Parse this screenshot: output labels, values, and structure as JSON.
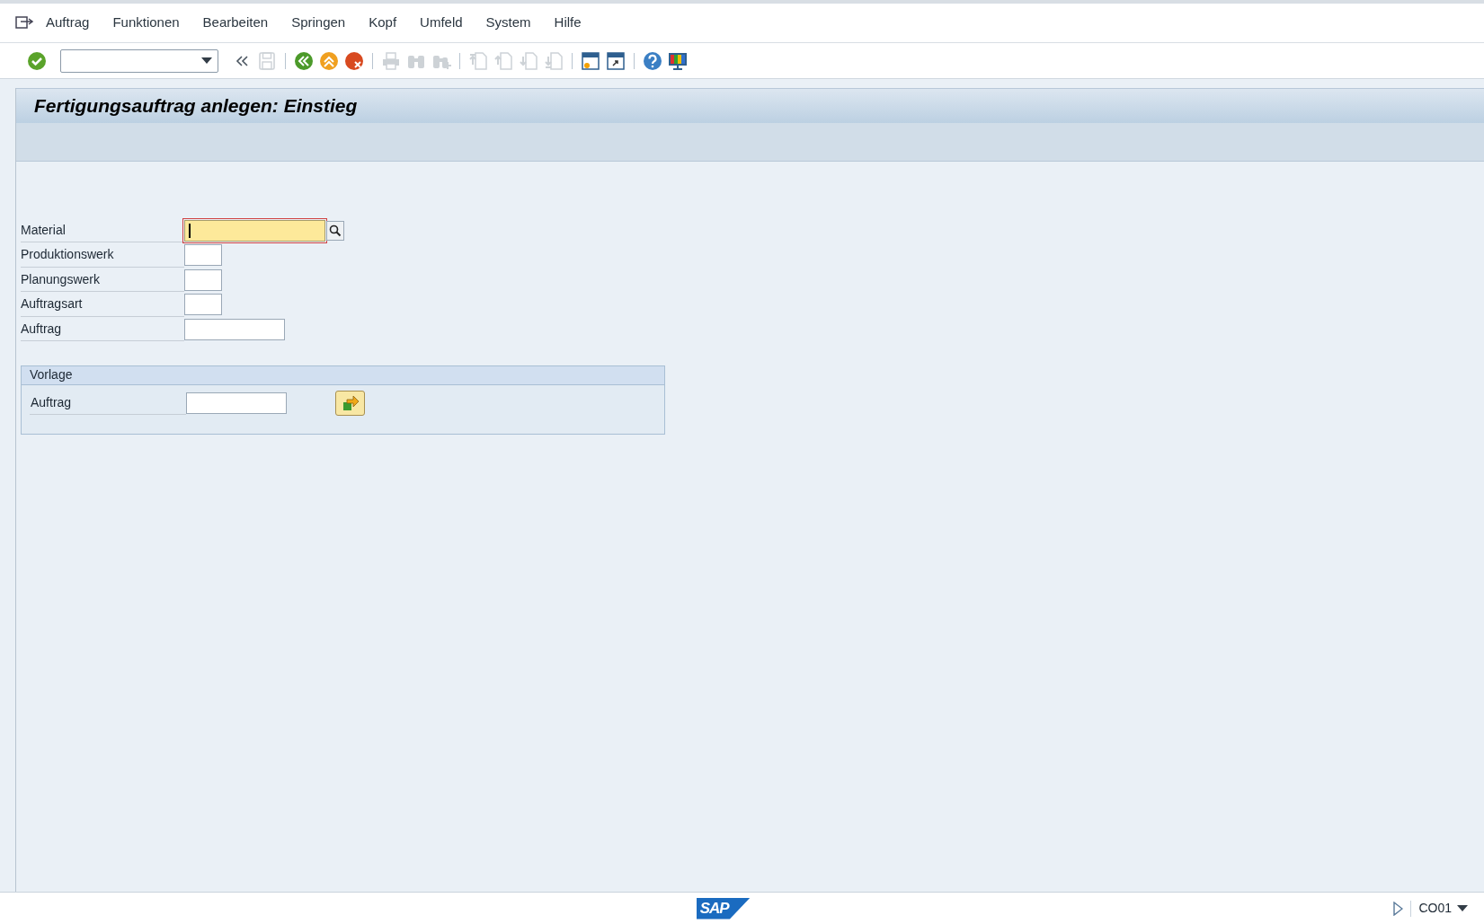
{
  "menu": [
    {
      "label": "Auftrag"
    },
    {
      "label": "Funktionen"
    },
    {
      "label": "Bearbeiten"
    },
    {
      "label": "Springen"
    },
    {
      "label": "Kopf"
    },
    {
      "label": "Umfeld"
    },
    {
      "label": "System"
    },
    {
      "label": "Hilfe"
    }
  ],
  "toolbar": [
    {
      "kind": "enter",
      "disabled": false
    },
    {
      "kind": "command",
      "disabled": false
    },
    {
      "kind": "collapse",
      "disabled": false
    },
    {
      "kind": "save",
      "disabled": true
    },
    {
      "kind": "sep"
    },
    {
      "kind": "back",
      "disabled": false
    },
    {
      "kind": "exit",
      "disabled": false
    },
    {
      "kind": "cancel",
      "disabled": false
    },
    {
      "kind": "sep"
    },
    {
      "kind": "print",
      "disabled": true
    },
    {
      "kind": "find",
      "disabled": true
    },
    {
      "kind": "findnext",
      "disabled": true
    },
    {
      "kind": "sep"
    },
    {
      "kind": "first",
      "disabled": true
    },
    {
      "kind": "prev",
      "disabled": true
    },
    {
      "kind": "next",
      "disabled": true
    },
    {
      "kind": "last",
      "disabled": true
    },
    {
      "kind": "sep"
    },
    {
      "kind": "session",
      "disabled": false
    },
    {
      "kind": "shortcut",
      "disabled": false
    },
    {
      "kind": "sep"
    },
    {
      "kind": "help",
      "disabled": false
    },
    {
      "kind": "layout",
      "disabled": false
    }
  ],
  "title": "Fertigungsauftrag anlegen: Einstieg",
  "fields": [
    {
      "label": "Material",
      "kind": "long",
      "focused": true,
      "search_help": true
    },
    {
      "label": "Produktionswerk",
      "kind": "short",
      "focused": false,
      "search_help": false
    },
    {
      "label": "Planungswerk",
      "kind": "short",
      "focused": false,
      "search_help": false
    },
    {
      "label": "Auftragsart",
      "kind": "short",
      "focused": false,
      "search_help": false
    },
    {
      "label": "Auftrag",
      "kind": "medium",
      "focused": false,
      "search_help": false
    }
  ],
  "template_group": {
    "title": "Vorlage",
    "fields": [
      {
        "label": "Auftrag",
        "kind": "medium"
      }
    ]
  },
  "status_bar": {
    "logo": "SAP",
    "transaction": "CO01"
  }
}
